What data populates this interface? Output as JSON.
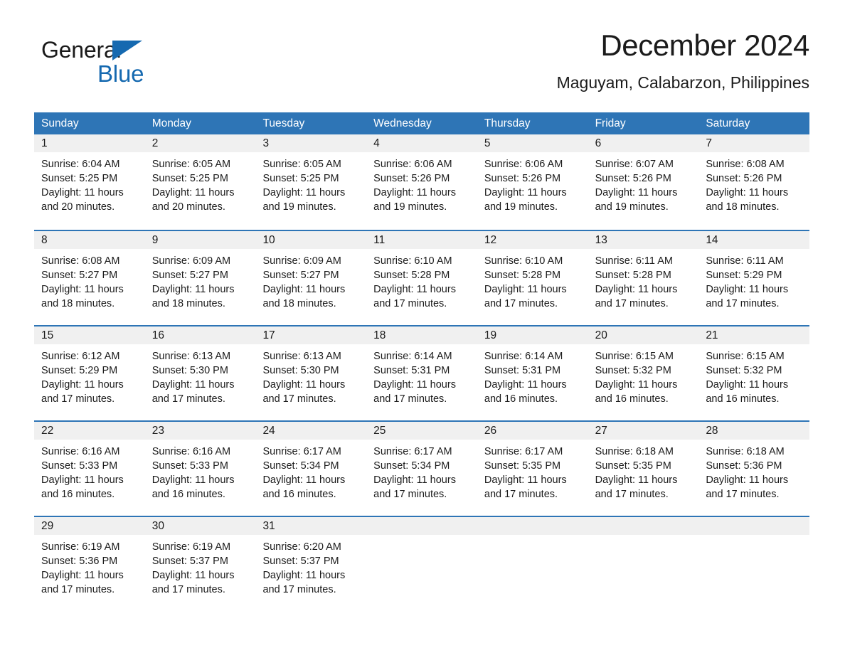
{
  "brand": {
    "name_top": "General",
    "name_bottom": "Blue",
    "color_blue": "#1569b0",
    "color_black": "#1a1a1a"
  },
  "header": {
    "title": "December 2024",
    "subtitle": "Maguyam, Calabarzon, Philippines"
  },
  "theme": {
    "header_blue": "#2e75b6",
    "date_band_gray": "#f0f0f0",
    "text_dark": "#1b1b1b",
    "cell_white": "#ffffff"
  },
  "weekdays": [
    "Sunday",
    "Monday",
    "Tuesday",
    "Wednesday",
    "Thursday",
    "Friday",
    "Saturday"
  ],
  "weeks": [
    [
      {
        "date": "1",
        "sunrise": "Sunrise: 6:04 AM",
        "sunset": "Sunset: 5:25 PM",
        "daylight": "Daylight: 11 hours and 20 minutes."
      },
      {
        "date": "2",
        "sunrise": "Sunrise: 6:05 AM",
        "sunset": "Sunset: 5:25 PM",
        "daylight": "Daylight: 11 hours and 20 minutes."
      },
      {
        "date": "3",
        "sunrise": "Sunrise: 6:05 AM",
        "sunset": "Sunset: 5:25 PM",
        "daylight": "Daylight: 11 hours and 19 minutes."
      },
      {
        "date": "4",
        "sunrise": "Sunrise: 6:06 AM",
        "sunset": "Sunset: 5:26 PM",
        "daylight": "Daylight: 11 hours and 19 minutes."
      },
      {
        "date": "5",
        "sunrise": "Sunrise: 6:06 AM",
        "sunset": "Sunset: 5:26 PM",
        "daylight": "Daylight: 11 hours and 19 minutes."
      },
      {
        "date": "6",
        "sunrise": "Sunrise: 6:07 AM",
        "sunset": "Sunset: 5:26 PM",
        "daylight": "Daylight: 11 hours and 19 minutes."
      },
      {
        "date": "7",
        "sunrise": "Sunrise: 6:08 AM",
        "sunset": "Sunset: 5:26 PM",
        "daylight": "Daylight: 11 hours and 18 minutes."
      }
    ],
    [
      {
        "date": "8",
        "sunrise": "Sunrise: 6:08 AM",
        "sunset": "Sunset: 5:27 PM",
        "daylight": "Daylight: 11 hours and 18 minutes."
      },
      {
        "date": "9",
        "sunrise": "Sunrise: 6:09 AM",
        "sunset": "Sunset: 5:27 PM",
        "daylight": "Daylight: 11 hours and 18 minutes."
      },
      {
        "date": "10",
        "sunrise": "Sunrise: 6:09 AM",
        "sunset": "Sunset: 5:27 PM",
        "daylight": "Daylight: 11 hours and 18 minutes."
      },
      {
        "date": "11",
        "sunrise": "Sunrise: 6:10 AM",
        "sunset": "Sunset: 5:28 PM",
        "daylight": "Daylight: 11 hours and 17 minutes."
      },
      {
        "date": "12",
        "sunrise": "Sunrise: 6:10 AM",
        "sunset": "Sunset: 5:28 PM",
        "daylight": "Daylight: 11 hours and 17 minutes."
      },
      {
        "date": "13",
        "sunrise": "Sunrise: 6:11 AM",
        "sunset": "Sunset: 5:28 PM",
        "daylight": "Daylight: 11 hours and 17 minutes."
      },
      {
        "date": "14",
        "sunrise": "Sunrise: 6:11 AM",
        "sunset": "Sunset: 5:29 PM",
        "daylight": "Daylight: 11 hours and 17 minutes."
      }
    ],
    [
      {
        "date": "15",
        "sunrise": "Sunrise: 6:12 AM",
        "sunset": "Sunset: 5:29 PM",
        "daylight": "Daylight: 11 hours and 17 minutes."
      },
      {
        "date": "16",
        "sunrise": "Sunrise: 6:13 AM",
        "sunset": "Sunset: 5:30 PM",
        "daylight": "Daylight: 11 hours and 17 minutes."
      },
      {
        "date": "17",
        "sunrise": "Sunrise: 6:13 AM",
        "sunset": "Sunset: 5:30 PM",
        "daylight": "Daylight: 11 hours and 17 minutes."
      },
      {
        "date": "18",
        "sunrise": "Sunrise: 6:14 AM",
        "sunset": "Sunset: 5:31 PM",
        "daylight": "Daylight: 11 hours and 17 minutes."
      },
      {
        "date": "19",
        "sunrise": "Sunrise: 6:14 AM",
        "sunset": "Sunset: 5:31 PM",
        "daylight": "Daylight: 11 hours and 16 minutes."
      },
      {
        "date": "20",
        "sunrise": "Sunrise: 6:15 AM",
        "sunset": "Sunset: 5:32 PM",
        "daylight": "Daylight: 11 hours and 16 minutes."
      },
      {
        "date": "21",
        "sunrise": "Sunrise: 6:15 AM",
        "sunset": "Sunset: 5:32 PM",
        "daylight": "Daylight: 11 hours and 16 minutes."
      }
    ],
    [
      {
        "date": "22",
        "sunrise": "Sunrise: 6:16 AM",
        "sunset": "Sunset: 5:33 PM",
        "daylight": "Daylight: 11 hours and 16 minutes."
      },
      {
        "date": "23",
        "sunrise": "Sunrise: 6:16 AM",
        "sunset": "Sunset: 5:33 PM",
        "daylight": "Daylight: 11 hours and 16 minutes."
      },
      {
        "date": "24",
        "sunrise": "Sunrise: 6:17 AM",
        "sunset": "Sunset: 5:34 PM",
        "daylight": "Daylight: 11 hours and 16 minutes."
      },
      {
        "date": "25",
        "sunrise": "Sunrise: 6:17 AM",
        "sunset": "Sunset: 5:34 PM",
        "daylight": "Daylight: 11 hours and 17 minutes."
      },
      {
        "date": "26",
        "sunrise": "Sunrise: 6:17 AM",
        "sunset": "Sunset: 5:35 PM",
        "daylight": "Daylight: 11 hours and 17 minutes."
      },
      {
        "date": "27",
        "sunrise": "Sunrise: 6:18 AM",
        "sunset": "Sunset: 5:35 PM",
        "daylight": "Daylight: 11 hours and 17 minutes."
      },
      {
        "date": "28",
        "sunrise": "Sunrise: 6:18 AM",
        "sunset": "Sunset: 5:36 PM",
        "daylight": "Daylight: 11 hours and 17 minutes."
      }
    ],
    [
      {
        "date": "29",
        "sunrise": "Sunrise: 6:19 AM",
        "sunset": "Sunset: 5:36 PM",
        "daylight": "Daylight: 11 hours and 17 minutes."
      },
      {
        "date": "30",
        "sunrise": "Sunrise: 6:19 AM",
        "sunset": "Sunset: 5:37 PM",
        "daylight": "Daylight: 11 hours and 17 minutes."
      },
      {
        "date": "31",
        "sunrise": "Sunrise: 6:20 AM",
        "sunset": "Sunset: 5:37 PM",
        "daylight": "Daylight: 11 hours and 17 minutes."
      },
      {
        "date": "",
        "sunrise": "",
        "sunset": "",
        "daylight": ""
      },
      {
        "date": "",
        "sunrise": "",
        "sunset": "",
        "daylight": ""
      },
      {
        "date": "",
        "sunrise": "",
        "sunset": "",
        "daylight": ""
      },
      {
        "date": "",
        "sunrise": "",
        "sunset": "",
        "daylight": ""
      }
    ]
  ]
}
